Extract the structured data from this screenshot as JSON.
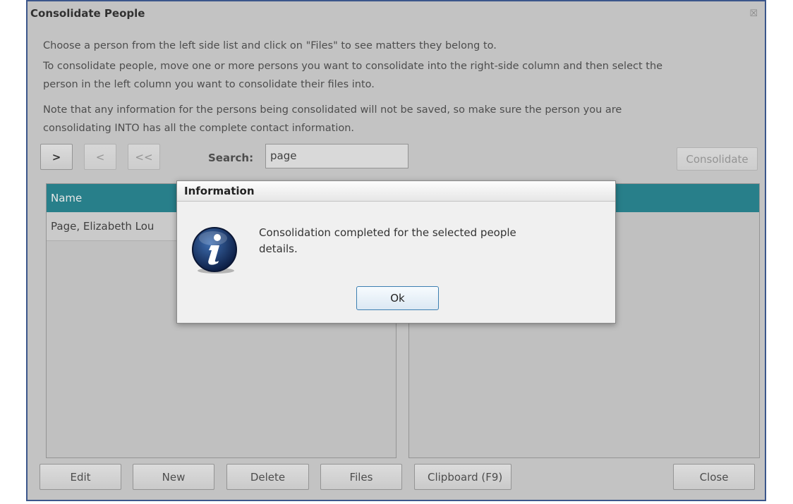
{
  "window": {
    "title": "Consolidate People",
    "close_glyph": "☒"
  },
  "instructions": {
    "line1": "Choose a person from the left side list and click on \"Files\" to see matters they belong to.",
    "line2a": "To consolidate people, move one or more persons you want to consolidate into the right-side column and then select the",
    "line2b": "person in the left column you want to consolidate their files into.",
    "line3a": "Note that any information for the persons being consolidated will not be saved, so make sure the person you are",
    "line3b": "consolidating INTO has all the complete contact information."
  },
  "toolbar": {
    "move_right": ">",
    "move_left": "<",
    "move_all_left": "<<",
    "search_label": "Search:",
    "search_value": "page",
    "consolidate": "Consolidate"
  },
  "left_list": {
    "header": "Name",
    "rows": [
      "Page, Elizabeth Lou"
    ]
  },
  "right_list": {
    "header": ""
  },
  "bottom_buttons": {
    "edit": "Edit",
    "new": "New",
    "delete": "Delete",
    "files": "Files",
    "clipboard": "Clipboard (F9)",
    "close": "Close"
  },
  "dialog": {
    "title": "Information",
    "message_line1": "Consolidation completed for the selected people",
    "message_line2": "details.",
    "ok": "Ok",
    "icon": "info-icon"
  },
  "colors": {
    "header_teal": "#17808e",
    "window_border": "#2e4f8f",
    "background": "#d4d4d4"
  }
}
